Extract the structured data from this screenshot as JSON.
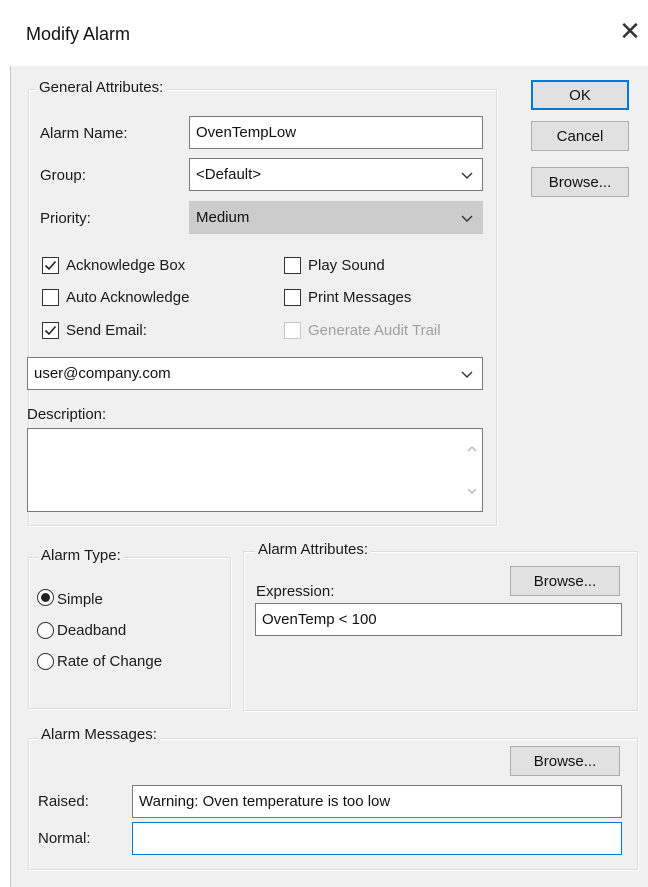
{
  "window": {
    "title": "Modify Alarm",
    "close_icon": "close-icon"
  },
  "buttons": {
    "ok": "OK",
    "cancel": "Cancel",
    "browse": "Browse..."
  },
  "general": {
    "legend": "General Attributes:",
    "alarm_name_label": "Alarm Name:",
    "alarm_name_value": "OvenTempLow",
    "group_label": "Group:",
    "group_value": "<Default>",
    "priority_label": "Priority:",
    "priority_value": "Medium",
    "checkboxes": {
      "acknowledge_box": {
        "label": "Acknowledge Box",
        "checked": true
      },
      "auto_acknowledge": {
        "label": "Auto Acknowledge",
        "checked": false
      },
      "send_email": {
        "label": "Send Email:",
        "checked": true
      },
      "play_sound": {
        "label": "Play Sound",
        "checked": false
      },
      "print_messages": {
        "label": "Print  Messages",
        "checked": false
      },
      "generate_audit_trail": {
        "label": "Generate Audit Trail",
        "checked": false,
        "disabled": true
      }
    },
    "email_value": "user@company.com",
    "description_label": "Description:",
    "description_value": ""
  },
  "alarm_type": {
    "legend": "Alarm Type:",
    "options": [
      "Simple",
      "Deadband",
      "Rate of Change"
    ],
    "selected": "Simple"
  },
  "alarm_attributes": {
    "legend": "Alarm Attributes:",
    "expression_label": "Expression:",
    "expression_value": "OvenTemp < 100",
    "browse": "Browse..."
  },
  "alarm_messages": {
    "legend": "Alarm Messages:",
    "browse": "Browse...",
    "raised_label": "Raised:",
    "raised_value": "Warning: Oven temperature is too low",
    "normal_label": "Normal:",
    "normal_value": ""
  },
  "colors": {
    "accent": "#0078d7",
    "dialog_bg": "#f0f0f0",
    "button_bg": "#e1e1e1"
  }
}
